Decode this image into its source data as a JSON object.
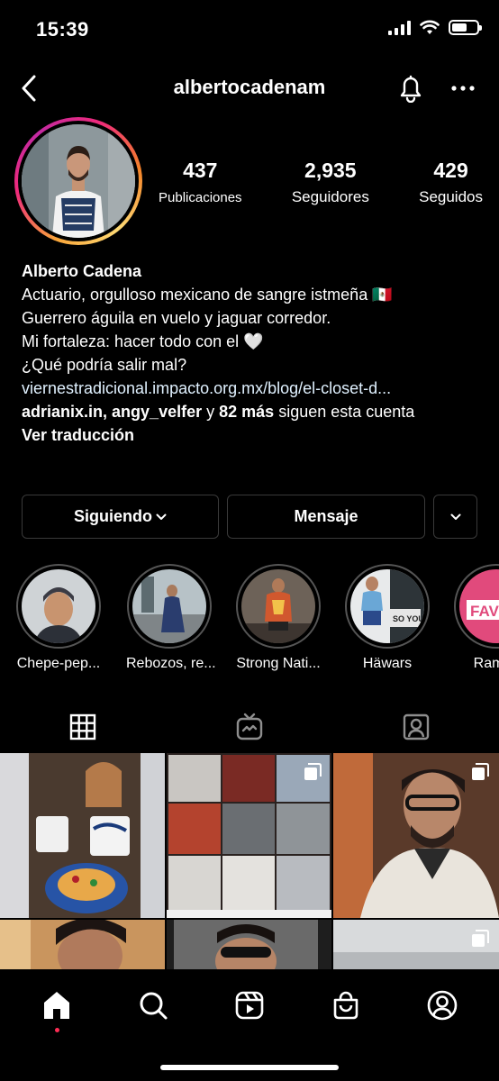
{
  "status_bar": {
    "time": "15:39",
    "battery_level": 0.6
  },
  "header": {
    "username": "albertocadenam"
  },
  "stats": [
    {
      "value": "437",
      "label": "Publicaciones"
    },
    {
      "value": "2,935",
      "label": "Seguidores"
    },
    {
      "value": "429",
      "label": "Seguidos"
    }
  ],
  "bio": {
    "name": "Alberto Cadena",
    "line1": "Actuario, orgulloso mexicano de sangre istmeña 🇲🇽",
    "line2": "Guerrero águila en vuelo y jaguar corredor.",
    "line3": "Mi fortaleza: hacer todo con el 🤍",
    "line4": "¿Qué podría salir mal?",
    "link": "viernestradicional.impacto.org.mx/blog/el-closet-d...",
    "followed_by_user1": "adrianix.in",
    "followed_by_sep": ", ",
    "followed_by_user2": "angy_velfer",
    "followed_by_and": " y ",
    "followed_by_more": "82 más",
    "followed_by_suffix": " siguen esta cuenta",
    "translate": "Ver traducción"
  },
  "actions": {
    "following": "Siguiendo",
    "message": "Mensaje"
  },
  "highlights": [
    {
      "label": "Chepe-pep..."
    },
    {
      "label": "Rebozos, re..."
    },
    {
      "label": "Strong Nati..."
    },
    {
      "label": "Häwars"
    },
    {
      "label": "Ramito"
    }
  ],
  "highlight_text": {
    "sign": "FAVO",
    "tee": "SO YOU"
  },
  "tabs": [
    {
      "name": "posts-grid",
      "icon": "grid-icon"
    },
    {
      "name": "igtv",
      "icon": "igtv-icon"
    },
    {
      "name": "tagged",
      "icon": "tagged-icon"
    }
  ],
  "bottom_nav": [
    {
      "name": "home",
      "icon": "home-icon"
    },
    {
      "name": "search",
      "icon": "search-icon"
    },
    {
      "name": "reels",
      "icon": "reels-icon"
    },
    {
      "name": "shop",
      "icon": "shop-icon"
    },
    {
      "name": "profile",
      "icon": "profile-icon"
    }
  ],
  "colors": {
    "accent_ring_start": "#feda75",
    "accent_ring_mid": "#ee2a7b",
    "link": "#e0f1ff",
    "border": "#3a3a3a"
  }
}
